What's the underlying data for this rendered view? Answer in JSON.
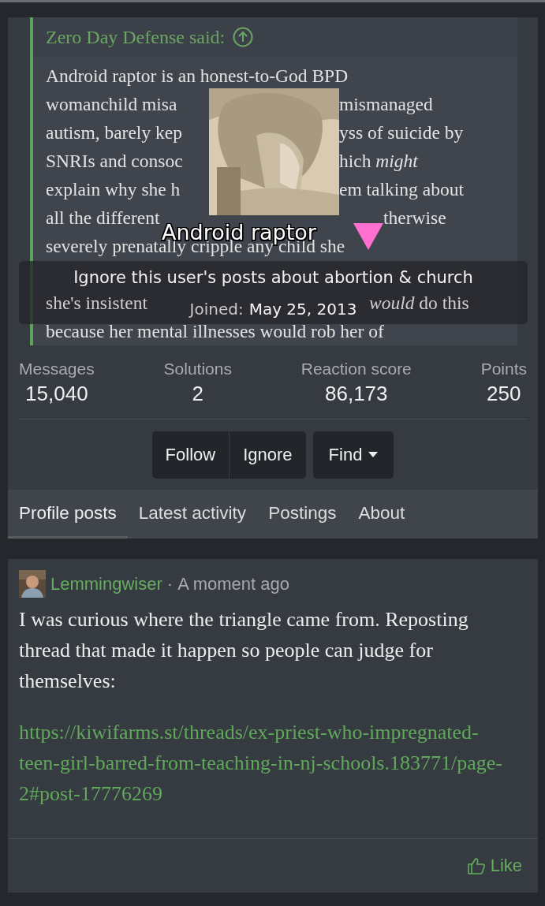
{
  "quote": {
    "author": "Zero Day Defense said:",
    "lines": [
      {
        "kind": "full",
        "text": "Android raptor is an honest-to-God BPD"
      },
      {
        "kind": "split",
        "left": "womanchild misa",
        "right": "mismanaged"
      },
      {
        "kind": "split",
        "left": "autism, barely kep",
        "right": "yss of suicide by"
      },
      {
        "kind": "split",
        "left": "SNRIs and consoc",
        "right": "hich *might*"
      },
      {
        "kind": "split",
        "left": "explain why she h",
        "right": "em talking about"
      },
      {
        "kind": "split_name",
        "left": "all the different",
        "right": "therwise"
      },
      {
        "kind": "full",
        "text": "severely prenatally cripple any child she"
      },
      {
        "kind": "hidden"
      },
      {
        "kind": "split_joined",
        "left": "she's insistent",
        "right": "*would* do this"
      },
      {
        "kind": "full",
        "text": "because her mental illnesses would rob her of"
      }
    ]
  },
  "profile": {
    "name": "Android raptor",
    "title": "Ignore this user's posts about abortion & church",
    "joined_label": "Joined:",
    "joined_date": "May 25, 2013"
  },
  "stats": [
    {
      "label": "Messages",
      "value": "15,040"
    },
    {
      "label": "Solutions",
      "value": "2"
    },
    {
      "label": "Reaction score",
      "value": "86,173"
    },
    {
      "label": "Points",
      "value": "250"
    }
  ],
  "button_groups": [
    [
      {
        "label": "Follow",
        "dropdown": false
      },
      {
        "label": "Ignore",
        "dropdown": false
      }
    ],
    [
      {
        "label": "Find",
        "dropdown": true
      }
    ]
  ],
  "tabs": [
    {
      "label": "Profile posts",
      "selected": true
    },
    {
      "label": "Latest activity",
      "selected": false
    },
    {
      "label": "Postings",
      "selected": false
    },
    {
      "label": "About",
      "selected": false
    }
  ],
  "post": {
    "author": "Lemmingwiser",
    "separator": "·",
    "time": "A moment ago",
    "text": "I was curious where the triangle came from. Reposting thread that made it happen so people can judge for themselves:",
    "link": "https://kiwifarms.st/threads/ex-priest-who-impregnated-teen-girl-barred-from-teaching-in-nj-schools.183771/page-2#post-17776269",
    "like": "Like"
  }
}
